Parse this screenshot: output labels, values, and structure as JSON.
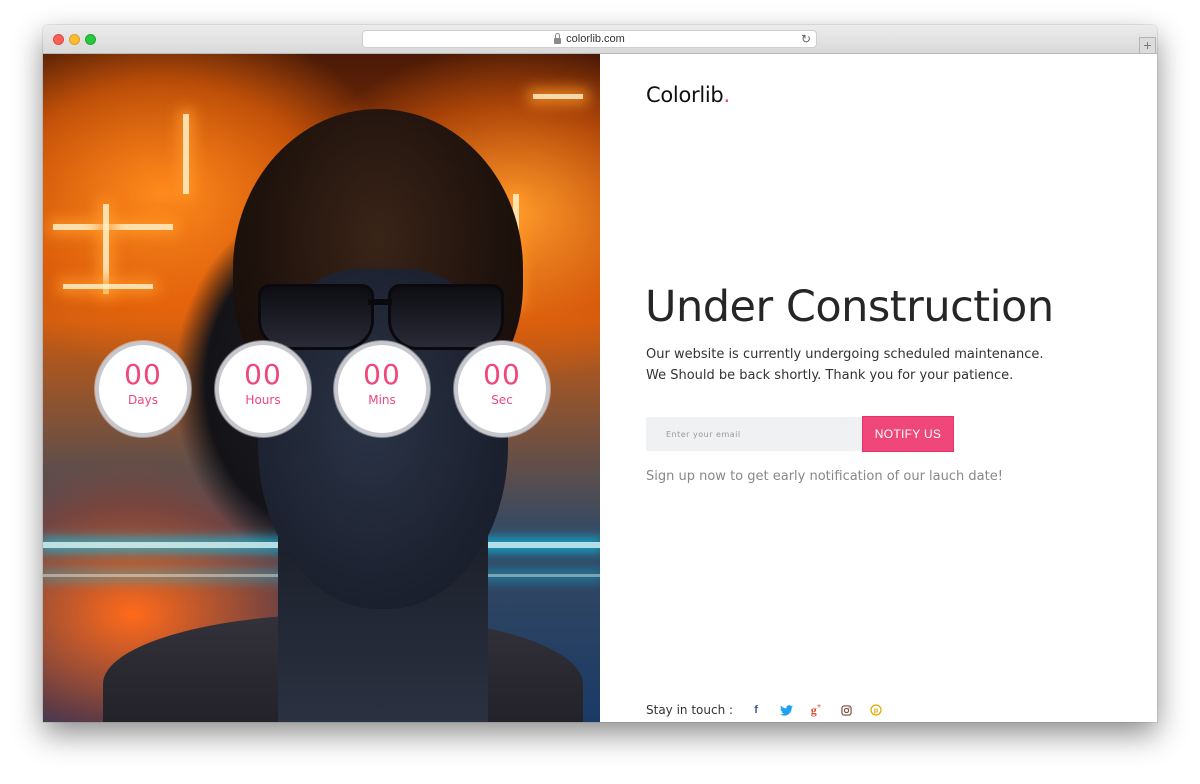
{
  "browser": {
    "url": "colorlib.com"
  },
  "countdown": [
    {
      "value": "00",
      "label": "Days"
    },
    {
      "value": "00",
      "label": "Hours"
    },
    {
      "value": "00",
      "label": "Mins"
    },
    {
      "value": "00",
      "label": "Sec"
    }
  ],
  "brand": {
    "name": "Colorlib",
    "dot": "."
  },
  "hero": {
    "title": "Under Construction",
    "description": "Our website is currently undergoing scheduled maintenance. We Should be back shortly. Thank you for your patience."
  },
  "subscribe": {
    "placeholder": "Enter your email",
    "button_label": "NOTIFY US",
    "note": "Sign up now to get early notification of our lauch date!"
  },
  "social": {
    "label": "Stay in touch :",
    "icons": [
      {
        "name": "facebook-icon",
        "glyph": "f",
        "color": "#3b5998"
      },
      {
        "name": "twitter-icon",
        "glyph": "t",
        "color": "#1da1f2"
      },
      {
        "name": "google-plus-icon",
        "glyph": "g+",
        "color": "#dd4b39"
      },
      {
        "name": "instagram-icon",
        "glyph": "ig",
        "color": "#7a4a3a"
      },
      {
        "name": "pinterest-icon",
        "glyph": "p",
        "color": "#e0a800"
      }
    ]
  },
  "colors": {
    "accent": "#f0477a",
    "title": "#262626",
    "muted": "#888888"
  }
}
